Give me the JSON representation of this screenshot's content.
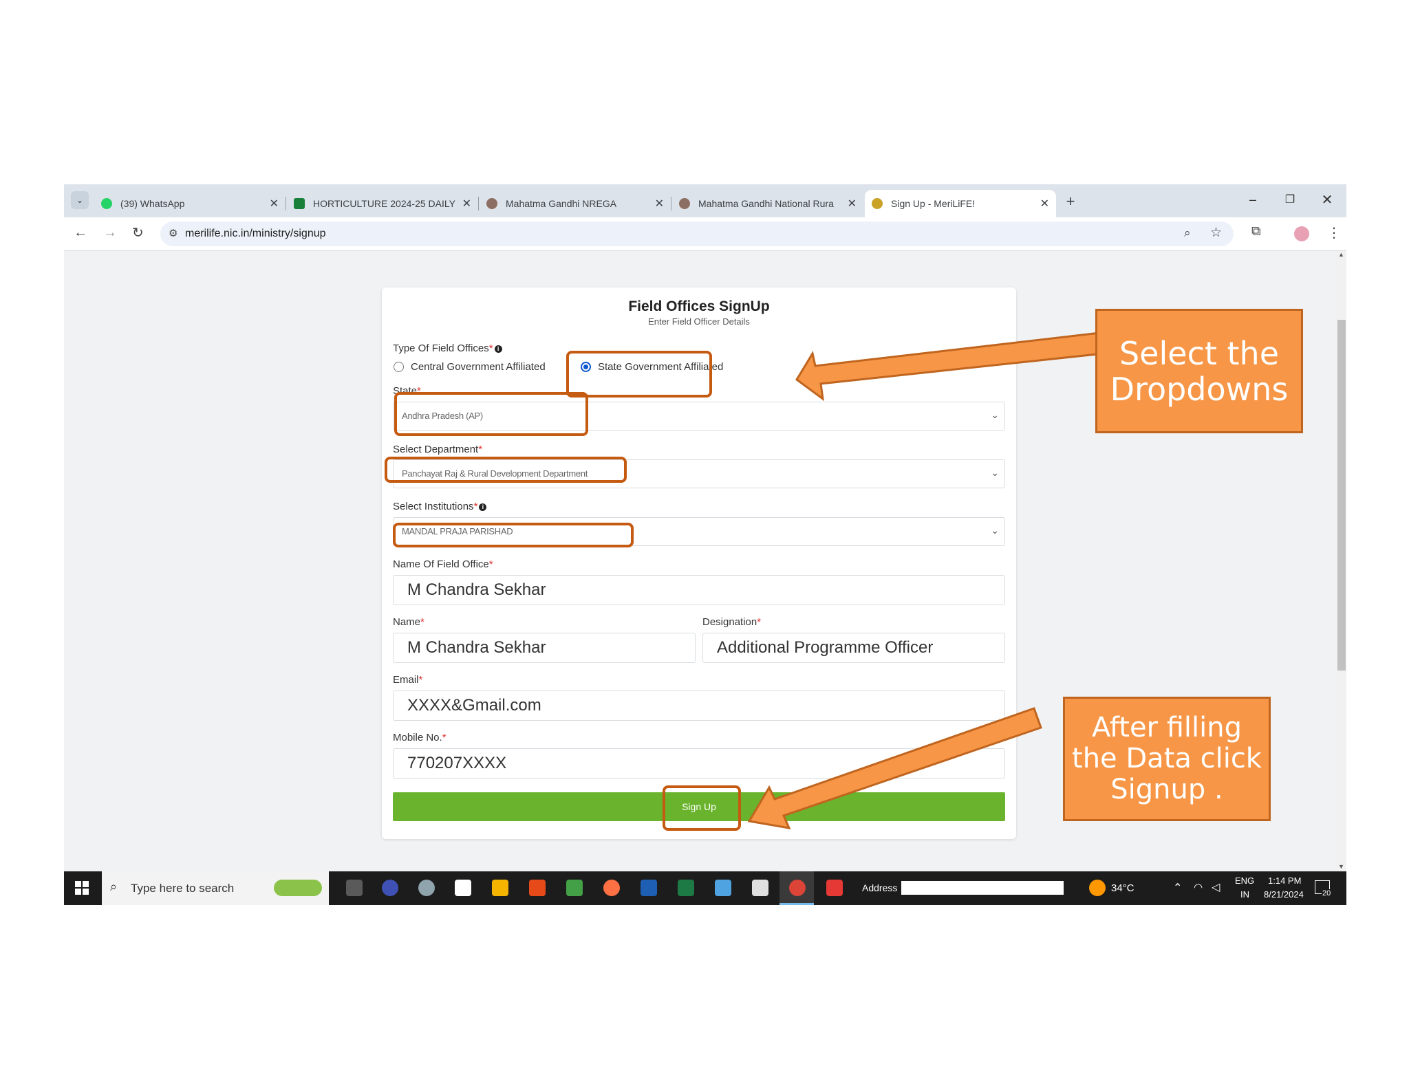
{
  "browser": {
    "tabs": [
      {
        "label": "(39) WhatsApp",
        "icon": "whatsapp-icon",
        "color": "#25d366"
      },
      {
        "label": "HORTICULTURE 2024-25 DAILY",
        "icon": "sheets-icon",
        "color": "#188038"
      },
      {
        "label": "Mahatma Gandhi NREGA",
        "icon": "nrega-icon",
        "color": "#8d6e63"
      },
      {
        "label": "Mahatma Gandhi National Rura",
        "icon": "nrega-icon",
        "color": "#8d6e63"
      },
      {
        "label": "Sign Up - MeriLiFE!",
        "icon": "merilife-icon",
        "color": "#c9a227",
        "active": true
      }
    ],
    "tab_close": "✕",
    "new_tab": "+",
    "url": "merilife.nic.in/ministry/signup"
  },
  "form": {
    "title": "Field Offices SignUp",
    "subtitle": "Enter Field Officer Details",
    "type_label": "Type Of Field Offices",
    "option_central": "Central Government Affiliated",
    "option_state": "State Government Affiliated",
    "state_label": "State",
    "state_value": "Andhra Pradesh (AP)",
    "department_label": "Select Department",
    "department_value": "Panchayat Raj & Rural Development Department",
    "institution_label": "Select Institutions",
    "institution_value": "MANDAL PRAJA PARISHAD",
    "field_office_label": "Name Of Field Office",
    "field_office_value": "M Chandra Sekhar",
    "name_label": "Name",
    "name_value": "M Chandra Sekhar",
    "designation_label": "Designation",
    "designation_value": "Additional Programme Officer",
    "email_label": "Email",
    "email_value": "XXXX&Gmail.com",
    "mobile_label": "Mobile No.",
    "mobile_value": "770207XXXX",
    "required_mark": "*",
    "signup_label": "Sign Up"
  },
  "taskbar": {
    "search_placeholder": "Type here to search",
    "address_label": "Address",
    "weather": "34°C",
    "lang_top": "ENG",
    "lang_bottom": "IN",
    "time": "1:14 PM",
    "date": "8/21/2024",
    "notifications": "20"
  },
  "callouts": {
    "dropdowns": [
      "Select the",
      "Dropdowns"
    ],
    "signup": [
      "After filling",
      "the Data click",
      "Signup ."
    ]
  },
  "colors": {
    "highlight_border": "#c55a11",
    "callout_fill": "#f79646",
    "signup_button": "#6ab42d",
    "radio_selected": "#0b57d0"
  }
}
